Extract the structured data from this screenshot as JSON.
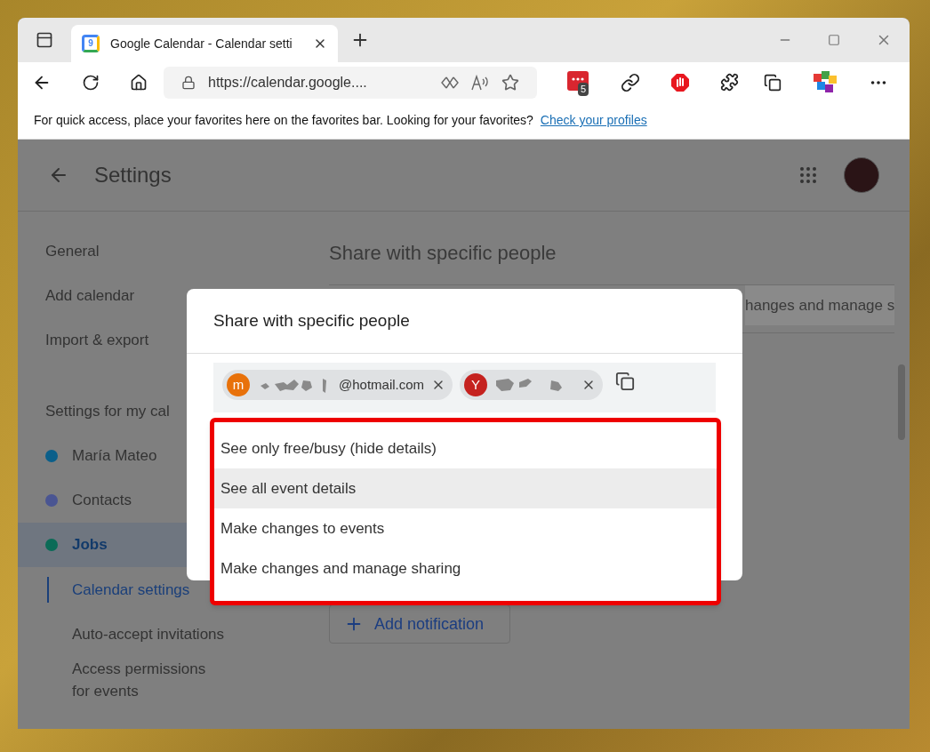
{
  "browser": {
    "tab": {
      "favicon": "9",
      "title": "Google Calendar - Calendar setti"
    },
    "address": "https://calendar.google....",
    "extension_badge": "5",
    "favorites_bar": {
      "message": "For quick access, place your favorites here on the favorites bar. Looking for your favorites?",
      "link": "Check your profiles"
    }
  },
  "page": {
    "title": "Settings",
    "sidebar": [
      {
        "kind": "link",
        "label": "General"
      },
      {
        "kind": "link",
        "label": "Add calendar"
      },
      {
        "kind": "link",
        "label": "Import & export"
      },
      {
        "kind": "heading",
        "label": "Settings for my cal"
      },
      {
        "kind": "calendar",
        "label": "María Mateo",
        "color": "#0b5f8a",
        "selected": false
      },
      {
        "kind": "calendar",
        "label": "Contacts",
        "color": "#4a5592",
        "selected": false
      },
      {
        "kind": "calendar",
        "label": "Jobs",
        "color": "#0b6b57",
        "selected": true
      },
      {
        "kind": "sub",
        "label": "Calendar settings",
        "selected": true
      },
      {
        "kind": "sub",
        "label": "Auto-accept invitations",
        "selected": false
      },
      {
        "kind": "sub",
        "label": "Access permissions for events",
        "selected": false
      }
    ],
    "section_title": "Share with specific people",
    "permission_field": "hanges and manage s",
    "add_button": "Add notification"
  },
  "dialog": {
    "title": "Share with specific people",
    "chips": [
      {
        "initial": "m",
        "color": "#e8710a",
        "email": "@hotmail.com"
      },
      {
        "initial": "Y",
        "color": "#c5221f"
      }
    ],
    "options": [
      {
        "label": "See only free/busy (hide details)",
        "selected": false
      },
      {
        "label": "See all event details",
        "selected": true
      },
      {
        "label": "Make changes to events",
        "selected": false
      },
      {
        "label": "Make changes and manage sharing",
        "selected": false
      }
    ]
  }
}
